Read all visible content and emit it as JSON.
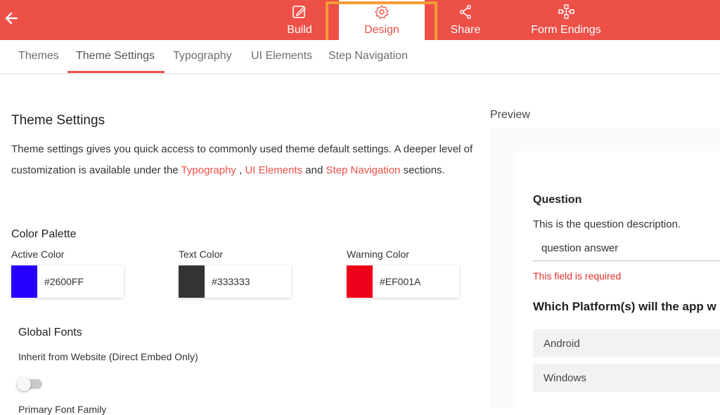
{
  "topbar": {
    "back_icon": "back-arrow-icon",
    "nav": [
      {
        "label": "Build",
        "icon": "edit-icon"
      },
      {
        "label": "Design",
        "icon": "gear-icon"
      },
      {
        "label": "Share",
        "icon": "share-icon"
      },
      {
        "label": "Form Endings",
        "icon": "flow-icon"
      }
    ],
    "active": "Design",
    "accent": "#EC5047",
    "highlight_color": "#F59A38"
  },
  "subtabs": [
    "Themes",
    "Theme Settings",
    "Typography",
    "UI Elements",
    "Step Navigation"
  ],
  "active_subtab": "Theme Settings",
  "theme_settings": {
    "heading": "Theme Settings",
    "description": {
      "part1": "Theme settings gives you quick access to commonly used theme default settings. A deeper level of customization is available under the ",
      "link1": "Typography",
      "sep1": " , ",
      "link2": "UI Elements",
      "sep2": " and ",
      "link3": "Step Navigation",
      "part2": " sections."
    },
    "color_palette": {
      "heading": "Color Palette",
      "colors": [
        {
          "label": "Active Color",
          "hex": "#2600FF"
        },
        {
          "label": "Text Color",
          "hex": "#333333"
        },
        {
          "label": "Warning Color",
          "hex": "#EF001A"
        }
      ]
    },
    "global_fonts": {
      "heading": "Global Fonts",
      "inherit_label": "Inherit from Website (Direct Embed Only)",
      "inherit_enabled": false,
      "next_label": "Primary Font Family"
    }
  },
  "preview": {
    "label": "Preview",
    "question_title": "Question",
    "question_description": "This is the question description.",
    "answer_value": "question answer",
    "error_text": "This field is required",
    "question2_title": "Which Platform(s) will the app w",
    "options": [
      "Android",
      "Windows"
    ]
  }
}
